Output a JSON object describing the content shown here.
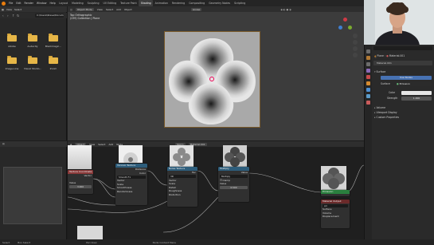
{
  "menu": {
    "items": [
      "File",
      "Edit",
      "Render",
      "Window",
      "Help"
    ],
    "tabs": [
      "Layout",
      "Modeling",
      "Sculpting",
      "UV Editing",
      "Texture Paint",
      "Shading",
      "Animation",
      "Rendering",
      "Compositing",
      "Geometry Nodes",
      "Scripting"
    ],
    "active_tab": "Shading",
    "scene": "Scene",
    "view_layer": "ViewLayer"
  },
  "file_browser": {
    "menu": [
      "View",
      "Select"
    ],
    "path": "C:\\Users\\Steve\\Docum",
    "folders": [
      {
        "label": "Adobe"
      },
      {
        "label": "Audacity"
      },
      {
        "label": "Blackmagic..."
      },
      {
        "label": "Image-Line"
      },
      {
        "label": "Visual Studio..."
      },
      {
        "label": "Zoom"
      }
    ]
  },
  "viewport": {
    "mode": "Object Mode",
    "menu": [
      "View",
      "Select",
      "Add",
      "Object"
    ],
    "shading": "Global",
    "info_line1": "Top Orthographic",
    "info_line2": "(239) Collection | Plane"
  },
  "node_editor": {
    "mode": "Object",
    "menu": [
      "View",
      "Select",
      "Add",
      "Node"
    ],
    "slot": "Slot 1",
    "material": "Material.001",
    "nodes": {
      "tex_coord": {
        "title": "Texture Coordinate",
        "output": "Vector"
      },
      "voronoi": {
        "title": "Voronoi Texture",
        "dim": "3D",
        "feature": "Smooth F1",
        "metric": "Euclidean",
        "out1": "Distance",
        "out2": "Color",
        "out3": "Position",
        "in1": "Vector",
        "in2": "Scale",
        "in3": "Smoothness",
        "in4": "Randomness"
      },
      "noise": {
        "title": "Noise Texture",
        "dim": "3D",
        "out1": "Fac",
        "out2": "Color",
        "in1": "Vector",
        "in2": "Scale",
        "in3": "Detail",
        "in4": "Roughness",
        "in5": "Distortion"
      },
      "math": {
        "title": "Multiply",
        "op": "Multiply",
        "clamp": "Clamp",
        "out": "Value",
        "in1": "Value",
        "value": "0.500"
      },
      "value": {
        "title": "Value",
        "out": "Value",
        "val": "3.000"
      },
      "emission": {
        "title": "Emission",
        "out": "Emission"
      },
      "output": {
        "title": "Material Output",
        "target": "All",
        "in1": "Surface",
        "in2": "Volume",
        "in3": "Displacement"
      }
    }
  },
  "properties": {
    "search_placeholder": "",
    "breadcrumb_obj": "Plane",
    "breadcrumb_mat": "Material.001",
    "material": "Material.001",
    "surface_label": "Surface",
    "surface_value": "Emission",
    "color_label": "Color",
    "strength_label": "Strength",
    "strength_value": "1.000",
    "volume_label": "Volume",
    "viewport_display_label": "Viewport Display",
    "custom_props_label": "Custom Properties",
    "use_nodes": "Use Nodes",
    "preview_label": "Preview"
  },
  "statusbar": {
    "items": [
      "Select",
      "Box Select",
      "Pan View",
      "Node Context Menu"
    ]
  },
  "colors": {
    "accent": "#e87d0d",
    "active_blue": "#4772b3",
    "node_texture_header": "#7a4f29",
    "node_input_header": "#8a3a3a",
    "node_shader_header": "#2a7f3e",
    "node_converter_header": "#2d5d7b",
    "node_output_header": "#6b2a2a"
  }
}
